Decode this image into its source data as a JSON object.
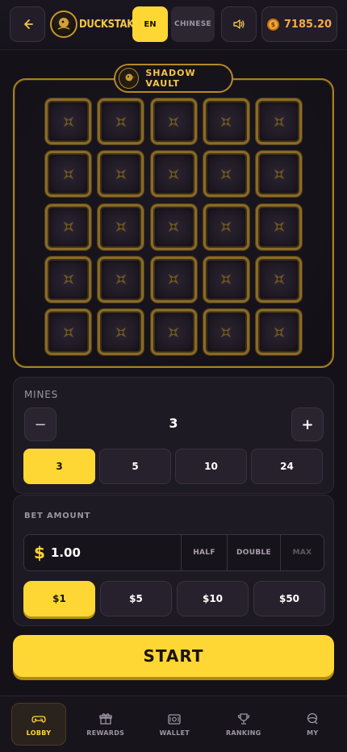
{
  "header": {
    "brand": "DUCKSTAKE",
    "lang_en": "EN",
    "lang_cn": "CHINESE",
    "balance": "7185.20"
  },
  "vault": {
    "title": "SHADOW VAULT",
    "rows": 5,
    "cols": 5
  },
  "mines": {
    "label": "MINES",
    "minus_label": "−",
    "plus_label": "+",
    "value": "3",
    "presets": [
      "3",
      "5",
      "10",
      "24"
    ],
    "active_preset": 0
  },
  "bet": {
    "label": "BET AMOUNT",
    "currency": "$",
    "value": "1.00",
    "half": "HALF",
    "double": "DOUBLE",
    "max": "MAX",
    "presets": [
      "$1",
      "$5",
      "$10",
      "$50"
    ],
    "active_preset": 0
  },
  "start_label": "START",
  "nav": [
    {
      "label": "LOBBY",
      "icon": "gamepad-icon",
      "active": true
    },
    {
      "label": "REWARDS",
      "icon": "gift-icon",
      "active": false
    },
    {
      "label": "WALLET",
      "icon": "wallet-icon",
      "active": false
    },
    {
      "label": "RANKING",
      "icon": "trophy-icon",
      "active": false
    },
    {
      "label": "MY",
      "icon": "user-icon",
      "active": false
    }
  ],
  "colors": {
    "accent": "#ffd735",
    "gold": "#a8801f",
    "balance": "#f5a84a"
  }
}
